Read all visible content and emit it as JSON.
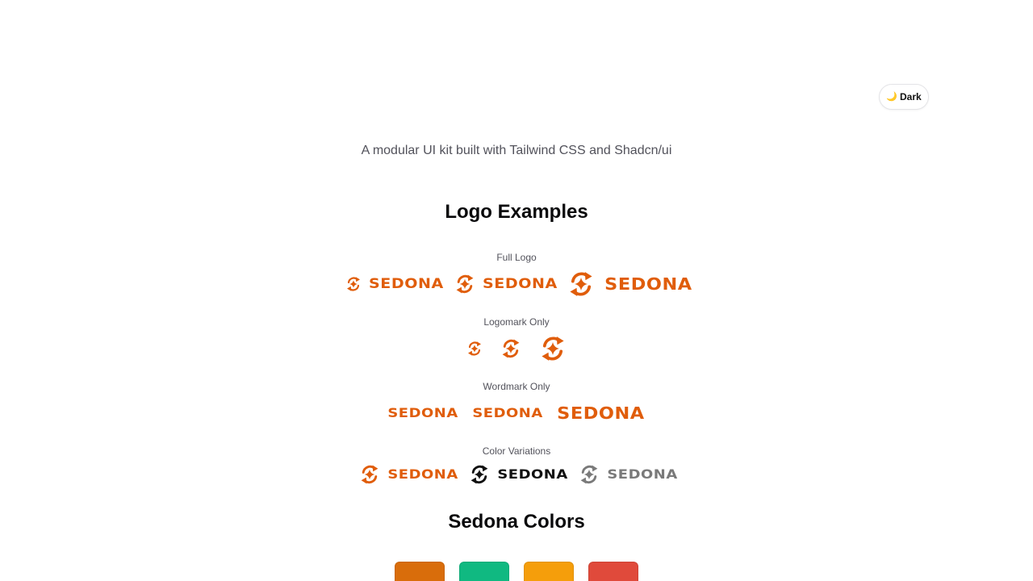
{
  "header": {
    "theme_toggle": {
      "icon": "moon-icon",
      "label": "Dark"
    }
  },
  "subtitle": "A modular UI kit built with Tailwind CSS and Shadcn/ui",
  "logo_section": {
    "title": "Logo Examples",
    "wordmark_text": "SEDONA",
    "rows": [
      {
        "label": "Full Logo"
      },
      {
        "label": "Logomark Only"
      },
      {
        "label": "Wordmark Only"
      },
      {
        "label": "Color Variations"
      }
    ],
    "color_variations": [
      "#e05d0b",
      "#111111",
      "#7a7a7a"
    ]
  },
  "colors_section": {
    "title": "Sedona Colors",
    "swatches": [
      "#d96d0b",
      "#10b981",
      "#f59e0b",
      "#e04a3b"
    ]
  },
  "brand_color": "#e05d0b"
}
